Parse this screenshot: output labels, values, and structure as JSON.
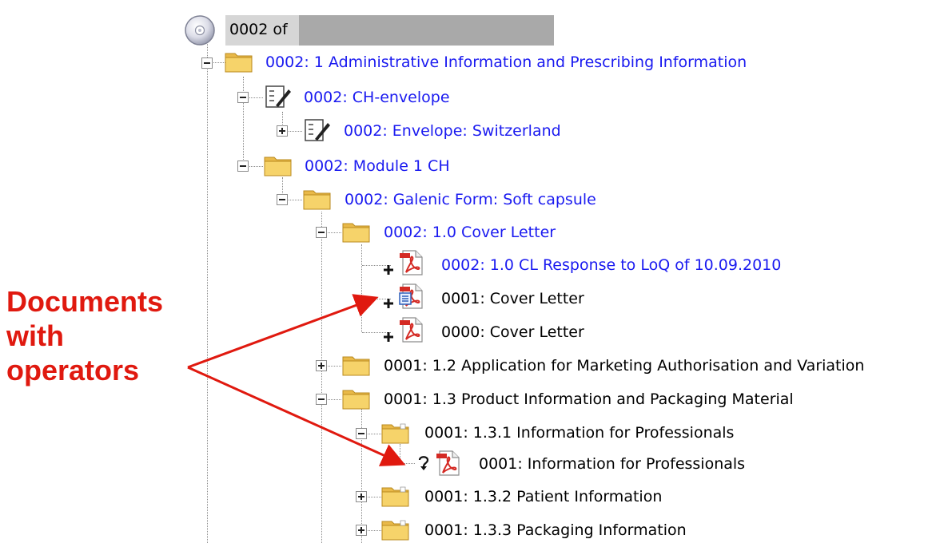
{
  "tree": {
    "root": {
      "label": "0002 of",
      "icon": "cd-disc-icon"
    },
    "nodes": [
      {
        "label": "0002: 1 Administrative Information and Prescribing Information",
        "color": "blue",
        "icon": "folder-icon",
        "toggle": "minus"
      },
      {
        "label": "0002: CH-envelope",
        "color": "blue",
        "icon": "envelope-form-icon",
        "toggle": "minus"
      },
      {
        "label": "0002: Envelope: Switzerland",
        "color": "blue",
        "icon": "envelope-form-icon",
        "toggle": "plus"
      },
      {
        "label": "0002: Module 1 CH",
        "color": "blue",
        "icon": "folder-icon",
        "toggle": "minus"
      },
      {
        "label": "0002: Galenic Form: Soft capsule",
        "color": "blue",
        "icon": "folder-icon",
        "toggle": "minus"
      },
      {
        "label": "0002: 1.0 Cover Letter",
        "color": "blue",
        "icon": "folder-icon",
        "toggle": "minus"
      },
      {
        "label": "0002: 1.0 CL Response to LoQ of 10.09.2010",
        "color": "blue",
        "icon": "pdf-document-icon",
        "operator": "new"
      },
      {
        "label": "0001: Cover Letter",
        "color": "black",
        "icon": "pdf-document-icon",
        "operator": "new"
      },
      {
        "label": "0000: Cover Letter",
        "color": "black",
        "icon": "pdf-document-icon",
        "operator": "new"
      },
      {
        "label": "0001: 1.2 Application for Marketing Authorisation and Variation",
        "color": "black",
        "icon": "folder-icon",
        "toggle": "plus"
      },
      {
        "label": "0001: 1.3 Product Information and Packaging Material",
        "color": "black",
        "icon": "folder-icon",
        "toggle": "minus"
      },
      {
        "label": "0001: 1.3.1 Information for Professionals",
        "color": "black",
        "icon": "folder-icon",
        "toggle": "minus"
      },
      {
        "label": "0001: Information for Professionals",
        "color": "black",
        "icon": "pdf-document-icon",
        "operator": "replace"
      },
      {
        "label": "0001: 1.3.2 Patient Information",
        "color": "black",
        "icon": "folder-icon",
        "toggle": "plus"
      },
      {
        "label": "0001: 1.3.3 Packaging Information",
        "color": "black",
        "icon": "folder-icon",
        "toggle": "plus"
      }
    ]
  },
  "annotation": {
    "lines": [
      "Documents",
      "with",
      "operators"
    ],
    "color": "#e0190f"
  },
  "colors": {
    "link_blue": "#1a1af0",
    "folder_yellow": "#f2cc5a",
    "pdf_red": "#d42a24"
  }
}
